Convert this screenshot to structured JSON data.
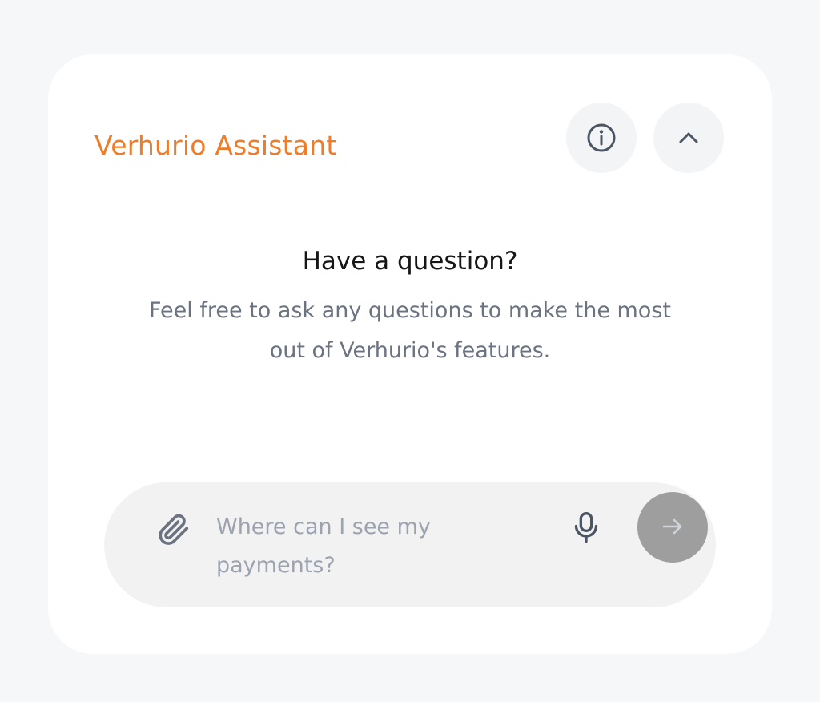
{
  "assistant": {
    "title": "Verhurio Assistant",
    "accent_color": "#f07c27"
  },
  "header_actions": {
    "info_icon": "info-circle-icon",
    "collapse_icon": "chevron-up-icon"
  },
  "empty_state": {
    "heading": "Have a question?",
    "description": "Feel free to ask any questions to make the most out of Verhurio's features."
  },
  "composer": {
    "attach_icon": "paperclip-icon",
    "placeholder": "Where can I see my payments?",
    "value": "",
    "mic_icon": "microphone-icon",
    "send_icon": "arrow-right-icon",
    "send_color": "#9e9e9e"
  }
}
